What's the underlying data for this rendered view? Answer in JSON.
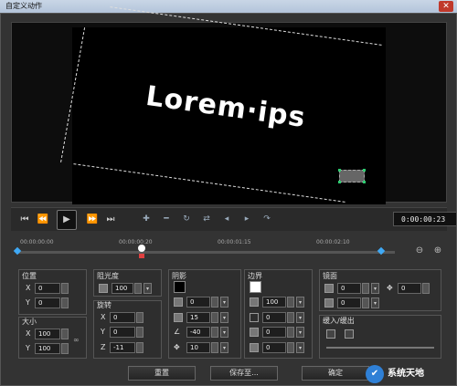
{
  "window": {
    "title": "自定义动作"
  },
  "preview": {
    "text": "Lorem·ips"
  },
  "playback": {
    "timecode": "0:00:00:23",
    "icons": [
      "skip-start-icon",
      "step-back-icon",
      "play-icon",
      "step-forward-icon",
      "skip-end-icon"
    ],
    "tools": [
      "add-keyframe-icon",
      "remove-keyframe-icon",
      "reverse-icon",
      "swap-icon",
      "prev-keyframe-icon",
      "next-keyframe-icon",
      "ease-icon"
    ]
  },
  "timeline": {
    "ticks": [
      "00:00:00:00",
      "00:00:00:20",
      "00:00:01:15",
      "00:00:02:10"
    ]
  },
  "position": {
    "title": "位置",
    "x_label": "X",
    "x": "0",
    "y_label": "Y",
    "y": "0"
  },
  "size": {
    "title": "大小",
    "x_label": "X",
    "x": "100",
    "y_label": "Y",
    "y": "100"
  },
  "opacity": {
    "title": "阻光度",
    "value": "100"
  },
  "rotation": {
    "title": "旋转",
    "x_label": "X",
    "x": "0",
    "y_label": "Y",
    "y": "0",
    "z_label": "Z",
    "z": "-11"
  },
  "shadow": {
    "title": "阴影",
    "v1": "0",
    "v2": "15",
    "v3": "-40",
    "v4": "10"
  },
  "border": {
    "title": "边界",
    "v1": "100",
    "v2": "0",
    "v3": "0",
    "v4": "0"
  },
  "mirror": {
    "title": "镜面",
    "v1": "0",
    "v2": "0",
    "v3": "0"
  },
  "fade": {
    "title": "缓入/缓出"
  },
  "buttons": {
    "reset": "重置",
    "save": "保存至...",
    "ok": "确定"
  },
  "watermark": {
    "text": "系统天地"
  }
}
